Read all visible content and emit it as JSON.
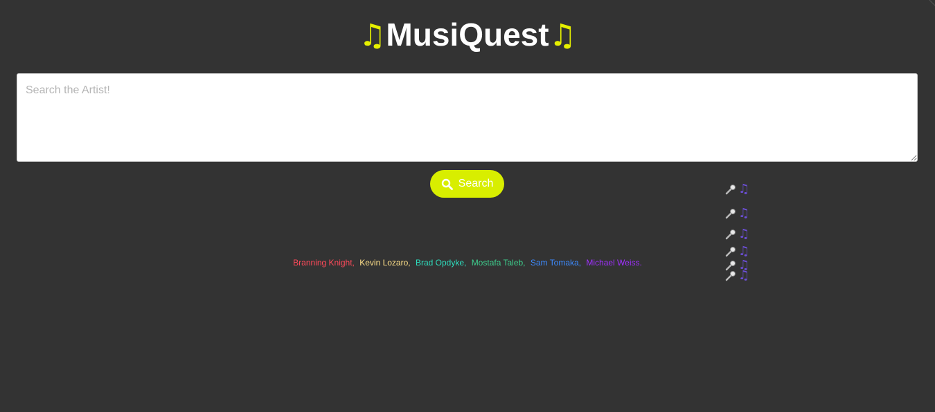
{
  "app": {
    "title": "MusiQuest",
    "title_note_left": "♫",
    "title_note_right": "♫"
  },
  "search": {
    "placeholder": "Search the Artist!",
    "value": "",
    "button_label": "Search",
    "button_icon": "search-icon"
  },
  "credits": [
    {
      "name": "Branning Knight,",
      "color": "#ff4a5a"
    },
    {
      "name": "Kevin Lozaro,",
      "color": "#ffe08a"
    },
    {
      "name": "Brad Opdyke,",
      "color": "#2ee0c0"
    },
    {
      "name": "Mostafa Taleb,",
      "color": "#3ecf8e"
    },
    {
      "name": "Sam Tomaka,",
      "color": "#3d8bff"
    },
    {
      "name": "Michael Weiss.",
      "color": "#a030ff"
    }
  ],
  "decor_icons": {
    "mic": "microphone-icon",
    "note": "♫",
    "count": 6
  },
  "colors": {
    "background": "#333333",
    "accent": "#d8ee00",
    "note_purple": "#6d4fd8"
  }
}
